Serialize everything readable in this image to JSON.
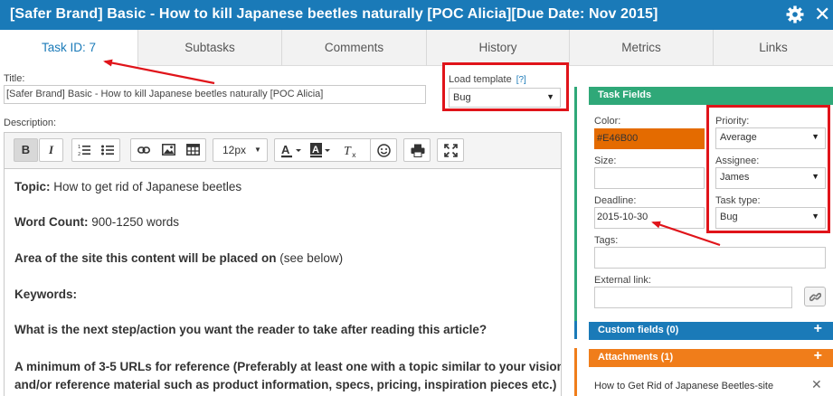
{
  "window": {
    "title": "[Safer Brand] Basic - How to kill Japanese beetles naturally [POC Alicia][Due Date: Nov 2015]",
    "settings_icon": "gear-icon",
    "close_icon": "close-icon",
    "close_glyph": "✕"
  },
  "tabs": [
    {
      "label": "Task ID: 7",
      "active": true
    },
    {
      "label": "Subtasks"
    },
    {
      "label": "Comments"
    },
    {
      "label": "History"
    },
    {
      "label": "Metrics"
    },
    {
      "label": "Links"
    }
  ],
  "form": {
    "title_label": "Title:",
    "title_value": "[Safer Brand] Basic - How to kill Japanese beetles naturally [POC Alicia]",
    "load_template_label": "Load template",
    "load_template_help": "[?]",
    "load_template_value": "Bug",
    "description_label": "Description:"
  },
  "editor_toolbar": {
    "bold": "B",
    "italic": "I",
    "font_size": "12px",
    "icons": [
      "ordered-list-icon",
      "unordered-list-icon",
      "link-icon",
      "image-icon",
      "table-icon",
      "font-color-icon",
      "background-color-icon",
      "clear-format-icon",
      "emoticon-icon",
      "print-icon",
      "fullscreen-icon"
    ]
  },
  "description": {
    "topic_label": "Topic:",
    "topic_value": " How to get rid of Japanese beetles",
    "word_count_label": "Word Count:",
    "word_count_value": " 900-1250 words",
    "area_label": "Area of the site this content will be placed on",
    "area_value": " (see below)",
    "keywords_label": "Keywords:",
    "next_step": "What is the next step/action you want the reader to take after reading this article?",
    "urls_line1": "A minimum of 3-5 URLs for reference (Preferably at least one with a topic similar to your vision,",
    "urls_line2": "and/or reference material such as product information, specs, pricing, inspiration pieces etc.)"
  },
  "task_fields": {
    "header": "Task Fields",
    "color_label": "Color:",
    "color_value": "#E46B00",
    "size_label": "Size:",
    "size_value": "",
    "deadline_label": "Deadline:",
    "deadline_value": "2015-10-30",
    "tags_label": "Tags:",
    "external_link_label": "External link:",
    "priority_label": "Priority:",
    "priority_value": "Average",
    "assignee_label": "Assignee:",
    "assignee_value": "James",
    "task_type_label": "Task type:",
    "task_type_value": "Bug"
  },
  "custom_fields": {
    "header": "Custom fields (0)",
    "add": "+"
  },
  "attachments": {
    "header": "Attachments (1)",
    "add": "+",
    "items": [
      {
        "name": "How to Get Rid of Japanese Beetles-site",
        "remove": "✕"
      }
    ]
  },
  "colors": {
    "brand_blue": "#1a7ab8",
    "task_fields_green": "#2fa878",
    "attachments_orange": "#f07d1a",
    "annotation_red": "#e0141a",
    "color_swatch": "#E46B00"
  }
}
